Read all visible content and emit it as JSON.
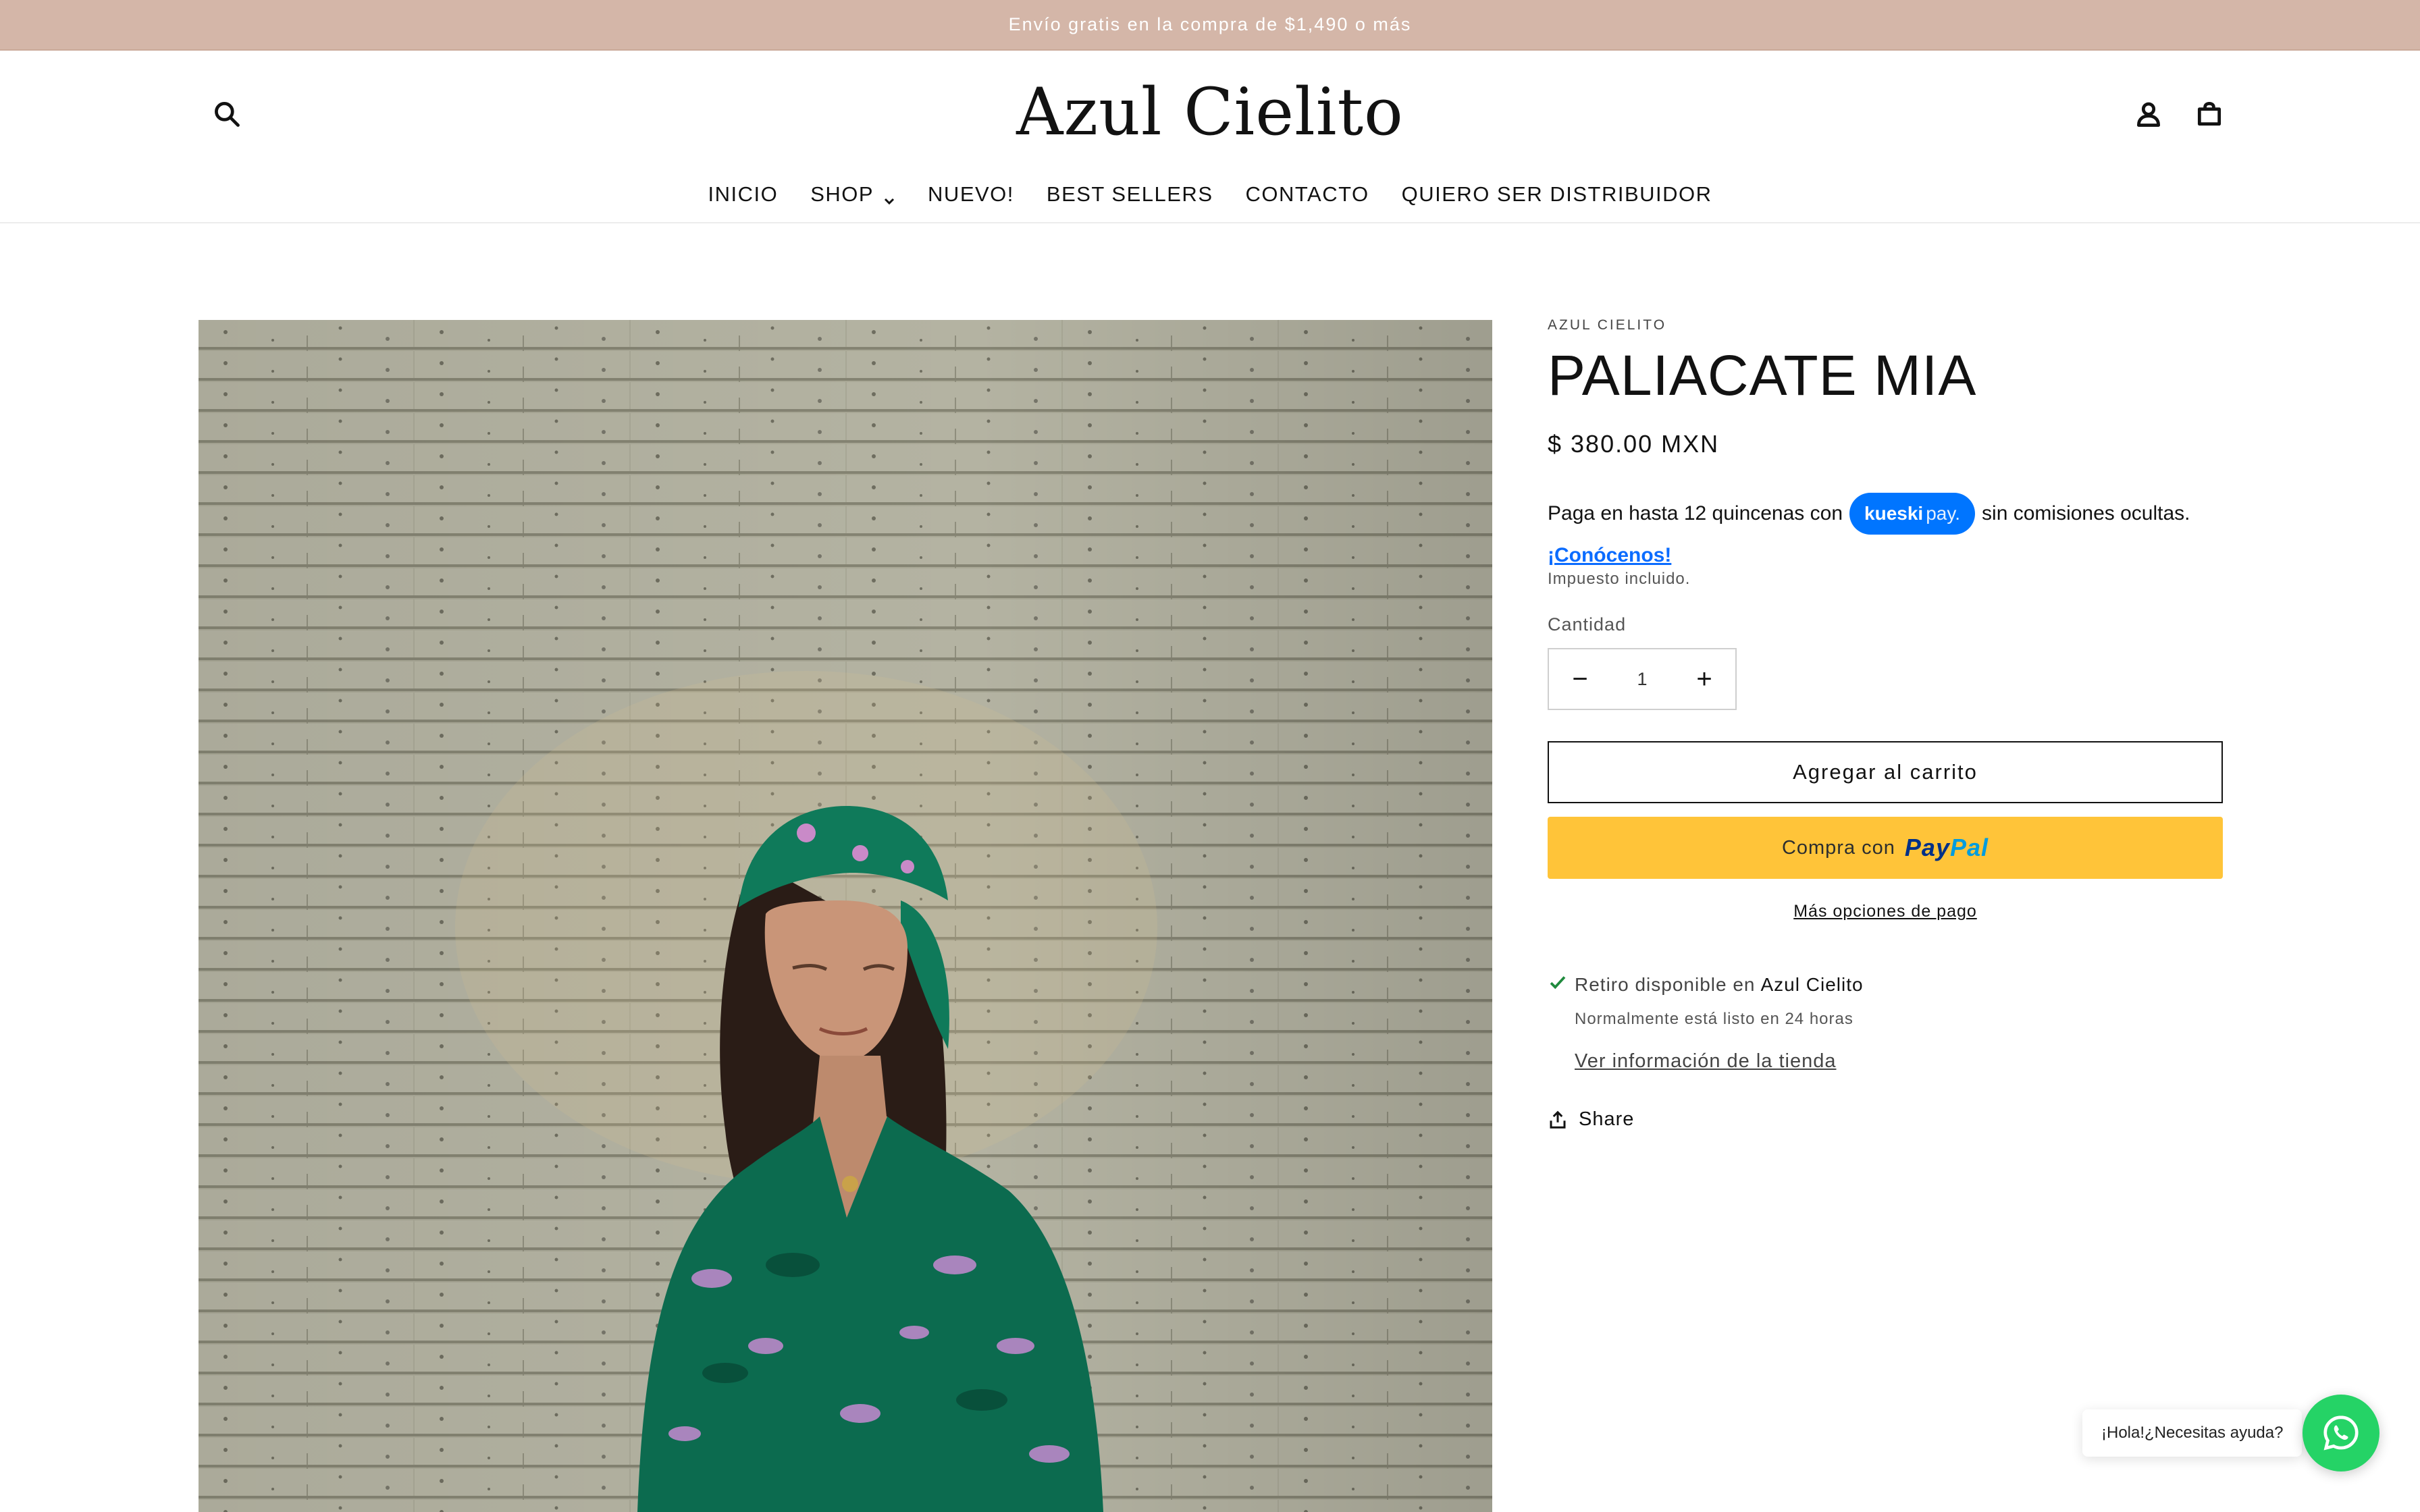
{
  "announcement": {
    "text": "Envío gratis en la compra de $1,490 o más"
  },
  "header": {
    "logo": "Azul Cielito",
    "icons": {
      "search": "search-icon",
      "account": "account-icon",
      "cart": "cart-icon"
    },
    "nav": [
      {
        "label": "INICIO"
      },
      {
        "label": "SHOP",
        "dropdown": true
      },
      {
        "label": "NUEVO!"
      },
      {
        "label": "BEST SELLERS"
      },
      {
        "label": "CONTACTO"
      },
      {
        "label": "QUIERO SER DISTRIBUIDOR"
      }
    ]
  },
  "product": {
    "vendor": "AZUL CIELITO",
    "title": "PALIACATE MIA",
    "price": "$ 380.00 MXN",
    "kueski": {
      "prefix": "Paga en hasta 12 quincenas con",
      "badge_brand": "kueski",
      "badge_pay": "pay.",
      "suffix": "sin comisiones ocultas.",
      "link": "¡Conócenos!"
    },
    "tax_note": "Impuesto incluido.",
    "quantity": {
      "label": "Cantidad",
      "value": "1",
      "minus": "−",
      "plus": "+"
    },
    "add_to_cart": "Agregar al carrito",
    "paypal": {
      "prefix": "Compra con",
      "pay": "Pay",
      "pal": "Pal"
    },
    "more_payment": "Más opciones de pago",
    "pickup": {
      "text": "Retiro disponible en",
      "store": "Azul Cielito",
      "note": "Normalmente está listo en 24 horas",
      "link": "Ver información de la tienda"
    },
    "share": "Share"
  },
  "whatsapp": {
    "bubble": "¡Hola!¿Necesitas ayuda?"
  },
  "colors": {
    "announcement_bg": "#d4b6a8",
    "kueski_blue": "#0075ff",
    "paypal_yellow": "#ffc439",
    "whatsapp_green": "#25d366"
  }
}
